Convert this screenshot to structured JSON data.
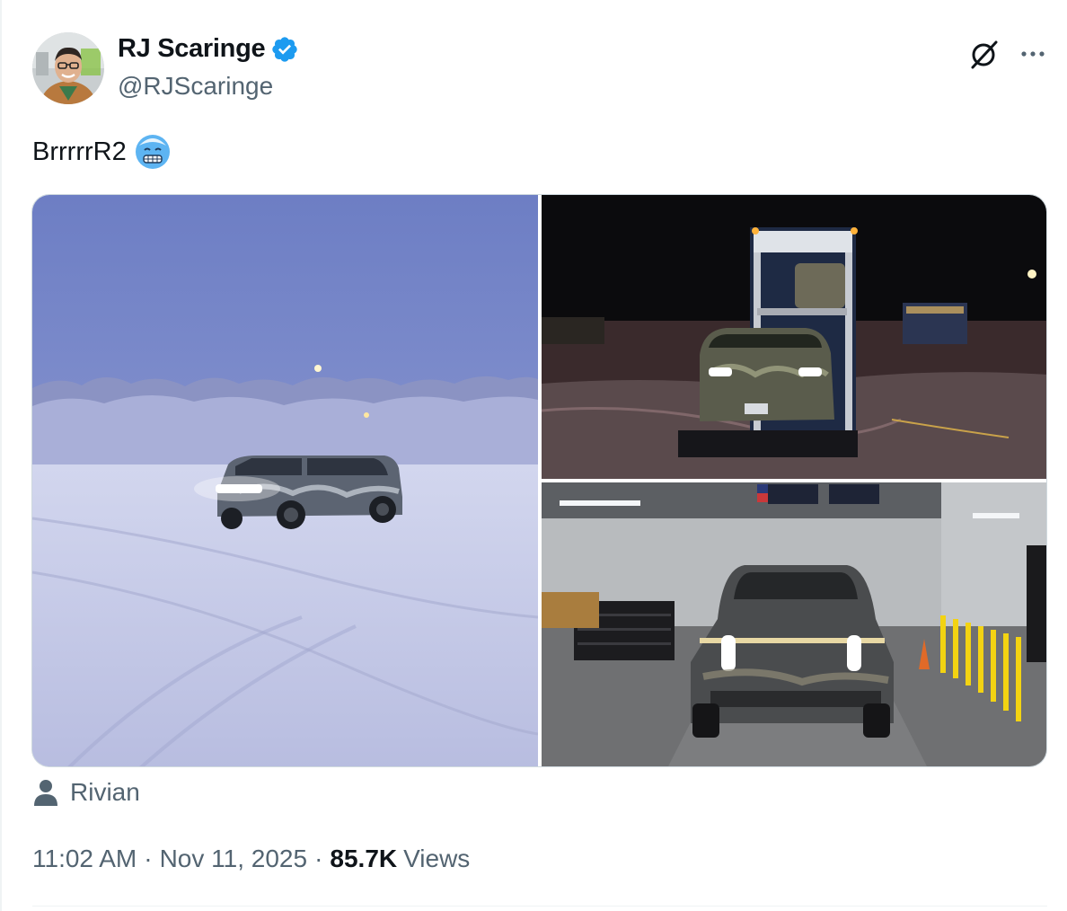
{
  "author": {
    "display_name": "RJ Scaringe",
    "handle": "@RJScaringe",
    "verified": true
  },
  "icons": {
    "avatar": "profile-photo",
    "verified": "verified-badge-icon",
    "grok": "grok-icon",
    "more": "more-dots-icon",
    "emoji": "cold-face-emoji",
    "tag": "person-icon"
  },
  "tweet": {
    "text": "BrrrrrR2"
  },
  "media": [
    {
      "scene": "snowy-field-suv"
    },
    {
      "scene": "night-car-transporter"
    },
    {
      "scene": "garage-truck-front"
    }
  ],
  "tagged_user": "Rivian",
  "meta": {
    "time": "11:02 AM",
    "separator": "·",
    "date": "Nov 11, 2025",
    "views_count": "85.7K",
    "views_label": "Views"
  },
  "colors": {
    "verified_blue": "#1d9bf0",
    "secondary_text": "#536471",
    "primary_text": "#0f1419"
  }
}
